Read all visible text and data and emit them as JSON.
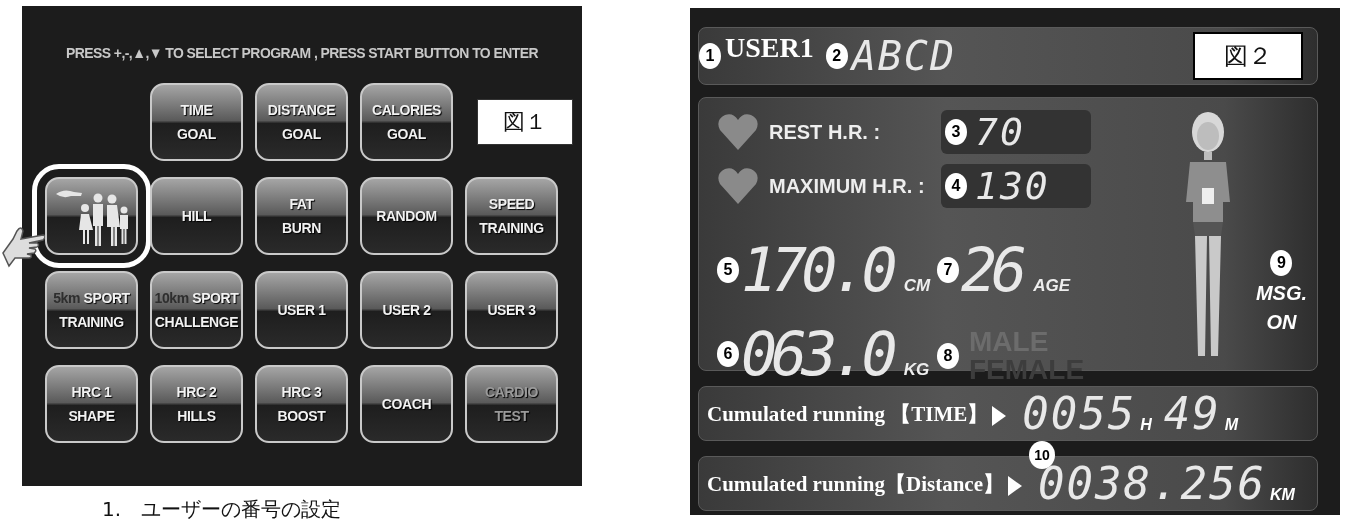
{
  "figure1": {
    "instruction": "PRESS +,-,▲,▼ TO SELECT PROGRAM , PRESS START BUTTON TO ENTER",
    "figure_label": "図１",
    "rows": [
      [
        "",
        {
          "kind": "text",
          "lines": [
            "TIME",
            "GOAL"
          ],
          "selected": false,
          "disabled": false
        },
        {
          "kind": "text",
          "lines": [
            "DISTANCE",
            "GOAL"
          ],
          "selected": false,
          "disabled": false
        },
        {
          "kind": "text",
          "lines": [
            "CALORIES",
            "GOAL"
          ],
          "selected": false,
          "disabled": false
        }
      ],
      [
        {
          "kind": "icon",
          "selected": true,
          "disabled": false
        },
        {
          "kind": "text",
          "lines": [
            "HILL"
          ],
          "selected": false,
          "disabled": false
        },
        {
          "kind": "text",
          "lines": [
            "FAT",
            "BURN"
          ],
          "selected": false,
          "disabled": false
        },
        {
          "kind": "text",
          "lines": [
            "RANDOM"
          ],
          "selected": false,
          "disabled": false
        },
        {
          "kind": "text",
          "lines": [
            "SPEED",
            "TRAINING"
          ],
          "selected": false,
          "disabled": false
        }
      ],
      [
        {
          "kind": "text",
          "prefix": "5km",
          "lines": [
            "SPORT",
            "TRAINING"
          ],
          "selected": false,
          "disabled": false
        },
        {
          "kind": "text",
          "prefix": "10km",
          "lines": [
            "SPORT",
            "CHALLENGE"
          ],
          "selected": false,
          "disabled": false
        },
        {
          "kind": "text",
          "lines": [
            "USER 1"
          ],
          "selected": false,
          "disabled": false
        },
        {
          "kind": "text",
          "lines": [
            "USER 2"
          ],
          "selected": false,
          "disabled": false
        },
        {
          "kind": "text",
          "lines": [
            "USER 3"
          ],
          "selected": false,
          "disabled": false
        }
      ],
      [
        {
          "kind": "text",
          "lines": [
            "HRC 1",
            "SHAPE"
          ],
          "selected": false,
          "disabled": false
        },
        {
          "kind": "text",
          "lines": [
            "HRC 2",
            "HILLS"
          ],
          "selected": false,
          "disabled": false
        },
        {
          "kind": "text",
          "lines": [
            "HRC 3",
            "BOOST"
          ],
          "selected": false,
          "disabled": false
        },
        {
          "kind": "text",
          "lines": [
            "COACH"
          ],
          "selected": false,
          "disabled": false
        },
        {
          "kind": "text",
          "lines": [
            "CARDIO",
            "TEST"
          ],
          "selected": false,
          "disabled": true
        }
      ]
    ]
  },
  "caption": "1.　ユーザーの番号の設定",
  "figure2": {
    "user_marker": "1",
    "user_label": "USER1",
    "name_marker": "2",
    "name": "ABCD",
    "figure_label": "図２",
    "heart_rates": [
      {
        "label": "REST H.R. :",
        "marker": "3",
        "value": "70"
      },
      {
        "label": "MAXIMUM H.R. :",
        "marker": "4",
        "value": "130"
      }
    ],
    "height": {
      "marker": "5",
      "value": "170.0",
      "unit": "CM"
    },
    "age": {
      "marker": "7",
      "value": "26",
      "unit": "AGE"
    },
    "weight": {
      "marker": "6",
      "value": "063.0",
      "unit": "KG"
    },
    "gender": {
      "marker": "8",
      "options": [
        {
          "label": "MALE",
          "selected": true
        },
        {
          "label": "FEMALE",
          "selected": false
        }
      ]
    },
    "message": {
      "marker": "9",
      "label": "MSG.",
      "state": "ON"
    },
    "time": {
      "label": "Cumulated running 【TIME】",
      "hours": "0055",
      "hours_unit": "H",
      "minutes": "49",
      "minutes_unit": "M"
    },
    "distance": {
      "label": "Cumulated running【Distance】",
      "marker": "10",
      "value": "0038.256",
      "unit": "KM"
    }
  }
}
